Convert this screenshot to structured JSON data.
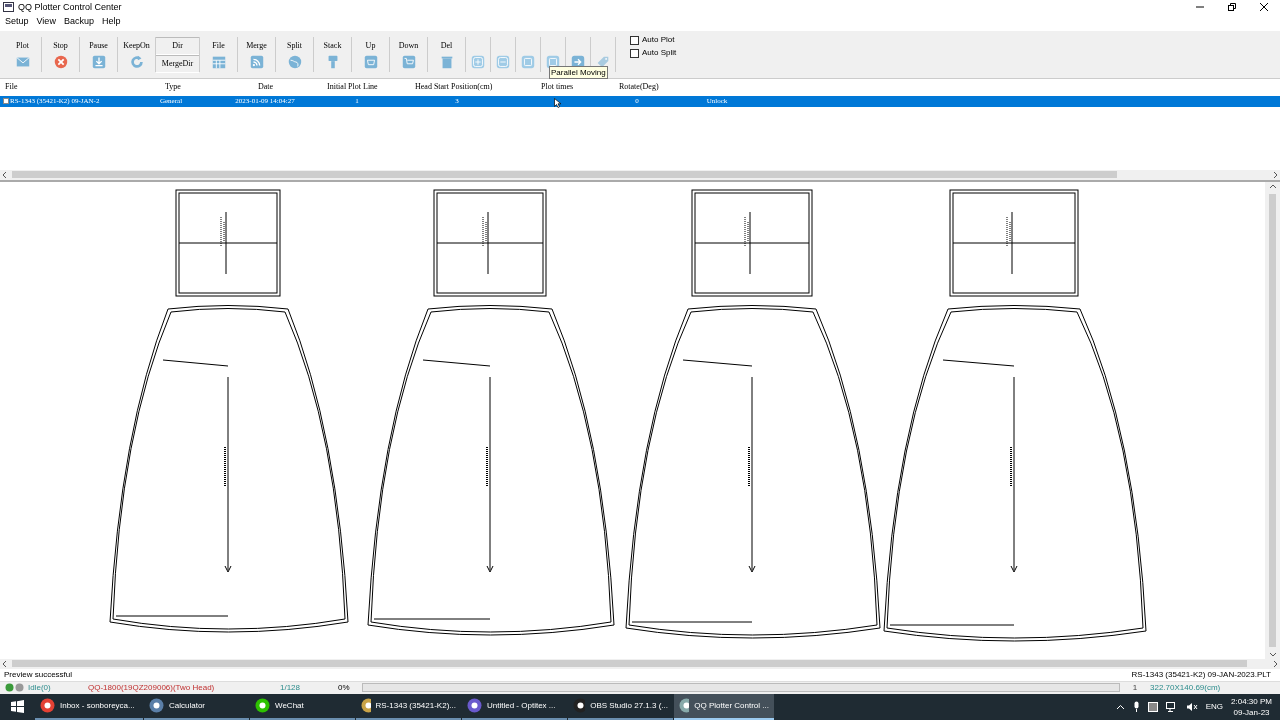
{
  "window": {
    "title": "QQ Plotter Control Center"
  },
  "menu": [
    "Setup",
    "View",
    "Backup",
    "Help"
  ],
  "toolbar": [
    {
      "kind": "button",
      "label": "Plot"
    },
    {
      "kind": "button",
      "label": "Stop"
    },
    {
      "kind": "button",
      "label": "Pause"
    },
    {
      "kind": "button",
      "label": "KeepOn"
    },
    {
      "kind": "stack",
      "labels": [
        "Dir",
        "MergeDir"
      ]
    },
    {
      "kind": "button",
      "label": "File"
    },
    {
      "kind": "button",
      "label": "Merge"
    },
    {
      "kind": "button",
      "label": "Split"
    },
    {
      "kind": "button",
      "label": "Stack"
    },
    {
      "kind": "button",
      "label": "Up"
    },
    {
      "kind": "button",
      "label": "Down"
    },
    {
      "kind": "button",
      "label": "Del"
    },
    {
      "kind": "icon"
    },
    {
      "kind": "icon"
    },
    {
      "kind": "icon"
    },
    {
      "kind": "icon"
    },
    {
      "kind": "icon"
    },
    {
      "kind": "icon"
    }
  ],
  "options": [
    {
      "label": "Auto Plot",
      "checked": false
    },
    {
      "label": "Auto Split",
      "checked": false
    }
  ],
  "tooltip": "Parallel Moving",
  "table": {
    "columns": [
      "File",
      "Type",
      "Date",
      "Initial Plot Line",
      "Head Start Position(cm)",
      "Plot times",
      "Rotate(Deg)"
    ],
    "rows": [
      {
        "selected": true,
        "cells": [
          "RS-1343 (35421-K2) 09-JAN-2",
          "General",
          "2023-01-09 14:04:27",
          "1",
          "3",
          "",
          "0",
          "Unlock"
        ]
      }
    ]
  },
  "status": {
    "message": "Preview successful",
    "file": "RS-1343 (35421-K2) 09-JAN-2023.PLT",
    "state": "Idle(0)",
    "device": "QQ-1800(19QZ209006)(Two Head)",
    "count": "1/128",
    "percent": "0%",
    "progress": {
      "level": 0
    },
    "copies": "1",
    "size": "322.70X140.69(cm)"
  },
  "taskbar": {
    "items": [
      {
        "label": "Inbox - sonboreyca...",
        "selected": false
      },
      {
        "label": "Calculator",
        "selected": false
      },
      {
        "label": "WeChat",
        "selected": false
      },
      {
        "label": "RS-1343 (35421-K2)...",
        "selected": false
      },
      {
        "label": "Untitled - Optitex ...",
        "selected": false
      },
      {
        "label": "OBS Studio 27.1.3 (...",
        "selected": false
      },
      {
        "label": "QQ Plotter Control ...",
        "selected": true
      }
    ],
    "language": "ENG",
    "time": "2:04:30 PM",
    "date": "09-Jan-23"
  }
}
